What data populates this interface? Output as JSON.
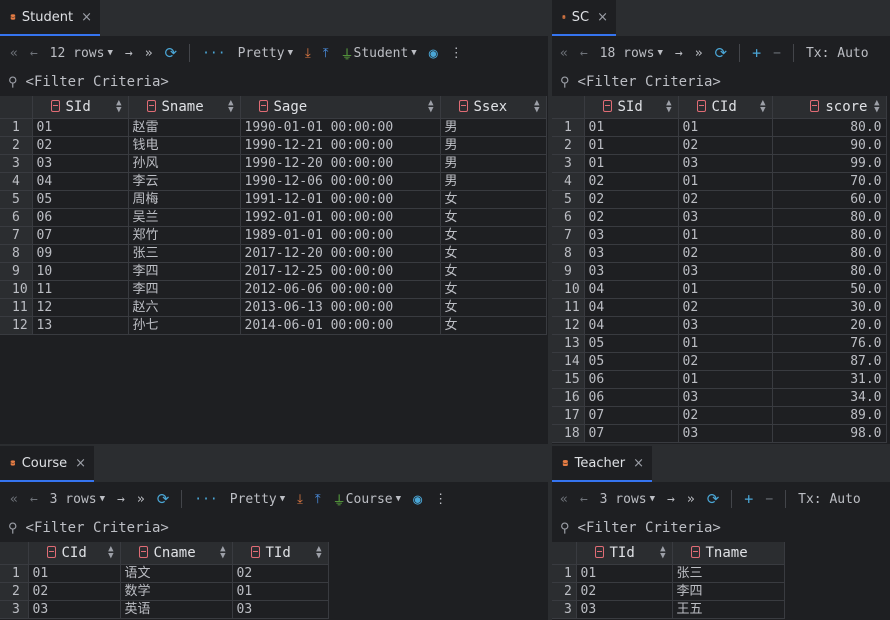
{
  "student": {
    "tab": "Student",
    "rows_label": "12 rows",
    "view_mode": "Pretty",
    "datasource": "Student",
    "filter": "<Filter Criteria>",
    "columns": [
      "SId",
      "Sname",
      "Sage",
      "Ssex"
    ],
    "rows": [
      [
        "1",
        "01",
        "赵雷",
        "1990-01-01 00:00:00",
        "男"
      ],
      [
        "2",
        "02",
        "钱电",
        "1990-12-21 00:00:00",
        "男"
      ],
      [
        "3",
        "03",
        "孙风",
        "1990-12-20 00:00:00",
        "男"
      ],
      [
        "4",
        "04",
        "李云",
        "1990-12-06 00:00:00",
        "男"
      ],
      [
        "5",
        "05",
        "周梅",
        "1991-12-01 00:00:00",
        "女"
      ],
      [
        "6",
        "06",
        "吴兰",
        "1992-01-01 00:00:00",
        "女"
      ],
      [
        "7",
        "07",
        "郑竹",
        "1989-01-01 00:00:00",
        "女"
      ],
      [
        "8",
        "09",
        "张三",
        "2017-12-20 00:00:00",
        "女"
      ],
      [
        "9",
        "10",
        "李四",
        "2017-12-25 00:00:00",
        "女"
      ],
      [
        "10",
        "11",
        "李四",
        "2012-06-06 00:00:00",
        "女"
      ],
      [
        "11",
        "12",
        "赵六",
        "2013-06-13 00:00:00",
        "女"
      ],
      [
        "12",
        "13",
        "孙七",
        "2014-06-01 00:00:00",
        "女"
      ]
    ]
  },
  "sc": {
    "tab": "SC",
    "rows_label": "18 rows",
    "tx_label": "Tx: Auto",
    "filter": "<Filter Criteria>",
    "columns": [
      "SId",
      "CId",
      "score"
    ],
    "rows": [
      [
        "1",
        "01",
        "01",
        "80.0"
      ],
      [
        "2",
        "01",
        "02",
        "90.0"
      ],
      [
        "3",
        "01",
        "03",
        "99.0"
      ],
      [
        "4",
        "02",
        "01",
        "70.0"
      ],
      [
        "5",
        "02",
        "02",
        "60.0"
      ],
      [
        "6",
        "02",
        "03",
        "80.0"
      ],
      [
        "7",
        "03",
        "01",
        "80.0"
      ],
      [
        "8",
        "03",
        "02",
        "80.0"
      ],
      [
        "9",
        "03",
        "03",
        "80.0"
      ],
      [
        "10",
        "04",
        "01",
        "50.0"
      ],
      [
        "11",
        "04",
        "02",
        "30.0"
      ],
      [
        "12",
        "04",
        "03",
        "20.0"
      ],
      [
        "13",
        "05",
        "01",
        "76.0"
      ],
      [
        "14",
        "05",
        "02",
        "87.0"
      ],
      [
        "15",
        "06",
        "01",
        "31.0"
      ],
      [
        "16",
        "06",
        "03",
        "34.0"
      ],
      [
        "17",
        "07",
        "02",
        "89.0"
      ],
      [
        "18",
        "07",
        "03",
        "98.0"
      ]
    ]
  },
  "course": {
    "tab": "Course",
    "rows_label": "3 rows",
    "view_mode": "Pretty",
    "datasource": "Course",
    "filter": "<Filter Criteria>",
    "columns": [
      "CId",
      "Cname",
      "TId"
    ],
    "rows": [
      [
        "1",
        "01",
        "语文",
        "02"
      ],
      [
        "2",
        "02",
        "数学",
        "01"
      ],
      [
        "3",
        "03",
        "英语",
        "03"
      ]
    ]
  },
  "teacher": {
    "tab": "Teacher",
    "rows_label": "3 rows",
    "tx_label": "Tx: Auto",
    "filter": "<Filter Criteria>",
    "columns": [
      "TId",
      "Tname"
    ],
    "rows": [
      [
        "1",
        "01",
        "张三"
      ],
      [
        "2",
        "02",
        "李四"
      ],
      [
        "3",
        "03",
        "王五"
      ]
    ]
  },
  "icons": {
    "first": "«",
    "prev": "←",
    "next": "→",
    "last": "»",
    "refresh": "⟳",
    "more": "···",
    "add": "+",
    "remove": "−",
    "download": "⤓",
    "upload": "⤒",
    "plug": "⏚",
    "view": "◉",
    "kebab": "⋮",
    "close": "×",
    "search": "⚲"
  },
  "colors": {
    "accent": "#3574f0",
    "bg": "#1e1f22",
    "panel": "#2b2d30",
    "key": "#e06c75"
  }
}
